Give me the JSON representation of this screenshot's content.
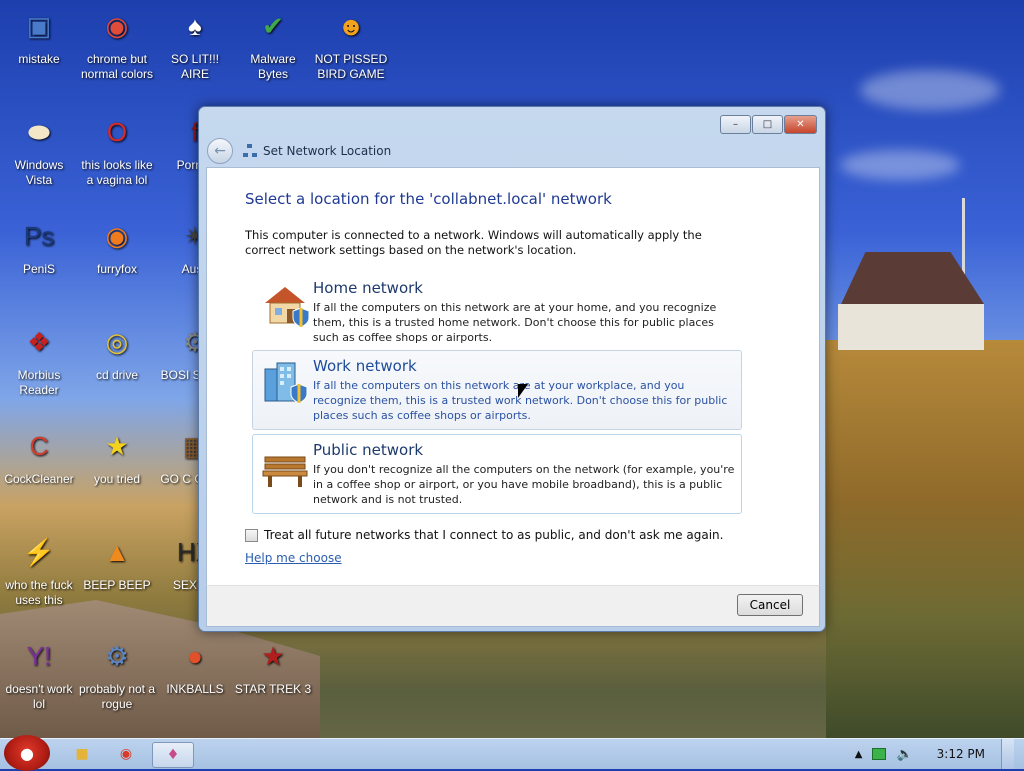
{
  "desktop": {
    "icons": [
      {
        "label": "mistake",
        "icon": "computer-icon",
        "color": "#4a7bc8"
      },
      {
        "label": "chrome but normal colors",
        "icon": "chrome-icon",
        "color": "#e04b3a"
      },
      {
        "label": "SO LIT!!! AIRE",
        "icon": "solitaire-icon",
        "color": "#ffffff"
      },
      {
        "label": "Malware Bytes",
        "icon": "malwarebytes-icon",
        "color": "#3ea84a"
      },
      {
        "label": "NOT PISSED BIRD GAME",
        "icon": "bad-piggies-icon",
        "color": "#f2a21b"
      },
      {
        "label": "Windows Vista",
        "icon": "egg-icon",
        "color": "#f4e7c8"
      },
      {
        "label": "this looks like a vagina lol",
        "icon": "opera-icon",
        "color": "#d62a2a"
      },
      {
        "label": "Porn P",
        "icon": "flash-icon",
        "color": "#8b1a1a"
      },
      {
        "label": "PeniS",
        "icon": "photoshop-icon",
        "color": "#1b3a7a"
      },
      {
        "label": "furryfox",
        "icon": "firefox-icon",
        "color": "#f07b1c"
      },
      {
        "label": "Austi",
        "icon": "spider-icon",
        "color": "#444444"
      },
      {
        "label": "Morbius Reader",
        "icon": "acrobat-icon",
        "color": "#c9211e"
      },
      {
        "label": "cd drive",
        "icon": "cd-icon",
        "color": "#e2c23a"
      },
      {
        "label": "BOSI SIMUL",
        "icon": "gear-icon",
        "color": "#8a8a8a"
      },
      {
        "label": "CockCleaner",
        "icon": "ccleaner-icon",
        "color": "#d33d2f"
      },
      {
        "label": "you tried",
        "icon": "star-icon",
        "color": "#f3d21e"
      },
      {
        "label": "GO C GADG",
        "icon": "briefcase-icon",
        "color": "#8a5a2a"
      },
      {
        "label": "who the fuck uses this",
        "icon": "flash-bolt-icon",
        "color": "#e8562a"
      },
      {
        "label": "BEEP BEEP",
        "icon": "vlc-icon",
        "color": "#f08a1c"
      },
      {
        "label": "SEX ED",
        "icon": "hx-icon",
        "color": "#2a2a2a"
      },
      {
        "label": "doesn't work lol",
        "icon": "yahoo-icon",
        "color": "#7b2fa0"
      },
      {
        "label": "probably not a rogue",
        "icon": "monitor-gears-icon",
        "color": "#5a86c4"
      },
      {
        "label": "INKBALLS",
        "icon": "inkball-icon",
        "color": "#e2502a"
      },
      {
        "label": "STAR TREK 3",
        "icon": "star-wars-icon",
        "color": "#b01e1e"
      }
    ]
  },
  "dialog": {
    "nav_title": "Set Network Location",
    "heading": "Select a location for the 'collabnet.local' network",
    "intro": "This computer is connected to a network. Windows will automatically apply the correct network settings based on the network's location.",
    "options": [
      {
        "title": "Home network",
        "description": "If all the computers on this network are at your home, and you recognize them, this is a trusted home network.  Don't choose this for public places such as coffee shops or airports.",
        "icon": "home-network-icon"
      },
      {
        "title": "Work network",
        "description": "If all the computers on this network are at your workplace, and you recognize them, this is a trusted work network.  Don't choose this for public places such as coffee shops or airports.",
        "icon": "work-network-icon"
      },
      {
        "title": "Public network",
        "description": "If you don't recognize all the computers on the network (for example, you're in a coffee shop or airport, or you have mobile broadband), this is a public network and is not trusted.",
        "icon": "public-network-icon"
      }
    ],
    "checkbox_label": "Treat all future networks that I connect to as public, and don't ask me again.",
    "help_link": "Help me choose",
    "cancel_label": "Cancel",
    "title_buttons": {
      "minimize": "–",
      "maximize": "□",
      "close": "✕"
    }
  },
  "taskbar": {
    "clock": "3:12 PM",
    "accent": "#a6c1e2"
  }
}
